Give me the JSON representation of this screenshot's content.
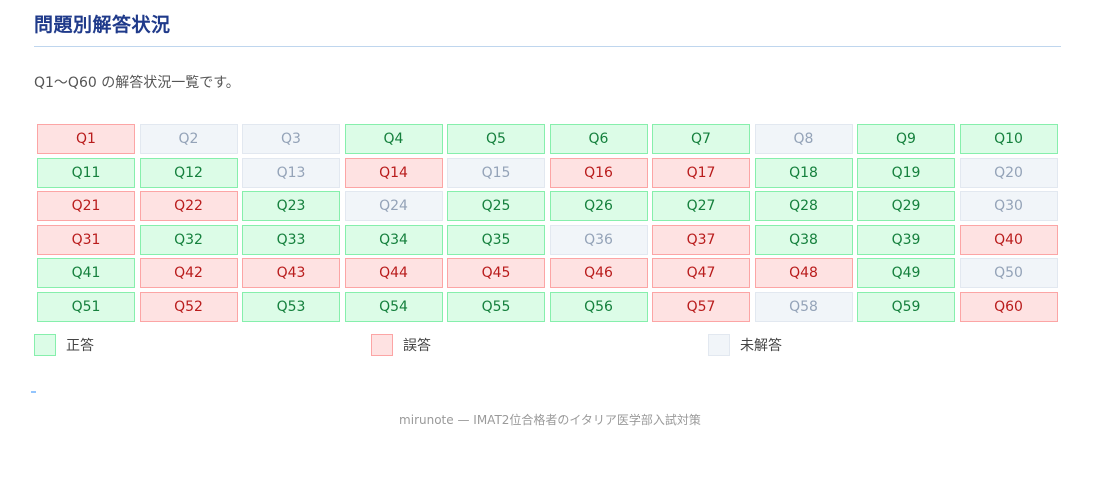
{
  "header": {
    "title": "問題別解答状況"
  },
  "description": "Q1〜Q60 の解答状況一覧です。",
  "questions": [
    {
      "label": "Q1",
      "status": "wrong"
    },
    {
      "label": "Q2",
      "status": "unanswered"
    },
    {
      "label": "Q3",
      "status": "unanswered"
    },
    {
      "label": "Q4",
      "status": "correct"
    },
    {
      "label": "Q5",
      "status": "correct"
    },
    {
      "label": "Q6",
      "status": "correct"
    },
    {
      "label": "Q7",
      "status": "correct"
    },
    {
      "label": "Q8",
      "status": "unanswered"
    },
    {
      "label": "Q9",
      "status": "correct"
    },
    {
      "label": "Q10",
      "status": "correct"
    },
    {
      "label": "Q11",
      "status": "correct"
    },
    {
      "label": "Q12",
      "status": "correct"
    },
    {
      "label": "Q13",
      "status": "unanswered"
    },
    {
      "label": "Q14",
      "status": "wrong"
    },
    {
      "label": "Q15",
      "status": "unanswered"
    },
    {
      "label": "Q16",
      "status": "wrong"
    },
    {
      "label": "Q17",
      "status": "wrong"
    },
    {
      "label": "Q18",
      "status": "correct"
    },
    {
      "label": "Q19",
      "status": "correct"
    },
    {
      "label": "Q20",
      "status": "unanswered"
    },
    {
      "label": "Q21",
      "status": "wrong"
    },
    {
      "label": "Q22",
      "status": "wrong"
    },
    {
      "label": "Q23",
      "status": "correct"
    },
    {
      "label": "Q24",
      "status": "unanswered"
    },
    {
      "label": "Q25",
      "status": "correct"
    },
    {
      "label": "Q26",
      "status": "correct"
    },
    {
      "label": "Q27",
      "status": "correct"
    },
    {
      "label": "Q28",
      "status": "correct"
    },
    {
      "label": "Q29",
      "status": "correct"
    },
    {
      "label": "Q30",
      "status": "unanswered"
    },
    {
      "label": "Q31",
      "status": "wrong"
    },
    {
      "label": "Q32",
      "status": "correct"
    },
    {
      "label": "Q33",
      "status": "correct"
    },
    {
      "label": "Q34",
      "status": "correct"
    },
    {
      "label": "Q35",
      "status": "correct"
    },
    {
      "label": "Q36",
      "status": "unanswered"
    },
    {
      "label": "Q37",
      "status": "wrong"
    },
    {
      "label": "Q38",
      "status": "correct"
    },
    {
      "label": "Q39",
      "status": "correct"
    },
    {
      "label": "Q40",
      "status": "wrong"
    },
    {
      "label": "Q41",
      "status": "correct"
    },
    {
      "label": "Q42",
      "status": "wrong"
    },
    {
      "label": "Q43",
      "status": "wrong"
    },
    {
      "label": "Q44",
      "status": "wrong"
    },
    {
      "label": "Q45",
      "status": "wrong"
    },
    {
      "label": "Q46",
      "status": "wrong"
    },
    {
      "label": "Q47",
      "status": "wrong"
    },
    {
      "label": "Q48",
      "status": "wrong"
    },
    {
      "label": "Q49",
      "status": "correct"
    },
    {
      "label": "Q50",
      "status": "unanswered"
    },
    {
      "label": "Q51",
      "status": "correct"
    },
    {
      "label": "Q52",
      "status": "wrong"
    },
    {
      "label": "Q53",
      "status": "correct"
    },
    {
      "label": "Q54",
      "status": "correct"
    },
    {
      "label": "Q55",
      "status": "correct"
    },
    {
      "label": "Q56",
      "status": "correct"
    },
    {
      "label": "Q57",
      "status": "wrong"
    },
    {
      "label": "Q58",
      "status": "unanswered"
    },
    {
      "label": "Q59",
      "status": "correct"
    },
    {
      "label": "Q60",
      "status": "wrong"
    }
  ],
  "legend": {
    "correct": "正答",
    "wrong": "誤答",
    "unanswered": "未解答"
  },
  "colors": {
    "correct_bg": "#dcfce7",
    "correct_text": "#15803d",
    "wrong_bg": "#fee2e2",
    "wrong_text": "#b91c1c",
    "unanswered_bg": "#f1f5f9",
    "unanswered_text": "#94a3b8",
    "title": "#1f3a8a"
  },
  "footer": "mirunote — IMAT2位合格者のイタリア医学部入試対策"
}
